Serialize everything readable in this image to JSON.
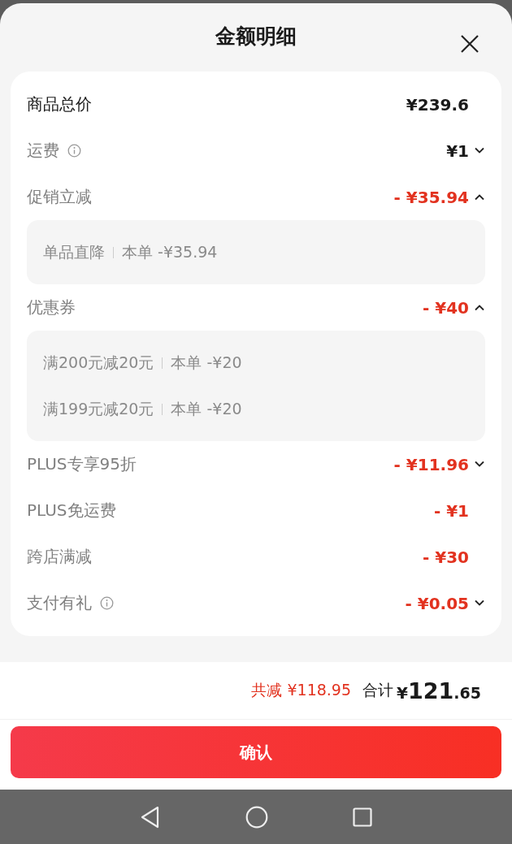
{
  "title": "金额明细",
  "rows": [
    {
      "label": "商品总价",
      "kind": "total",
      "info": false,
      "amount": "¥239.6",
      "collapsible": false
    },
    {
      "label": "运费",
      "kind": "charge",
      "info": true,
      "amount": "¥1",
      "collapsible": true,
      "expanded": false
    },
    {
      "label": "促销立减",
      "kind": "discount",
      "info": false,
      "amount": "- ¥35.94",
      "collapsible": true,
      "expanded": true,
      "details": [
        {
          "name": "单品直降",
          "value": "本单 -¥35.94"
        }
      ]
    },
    {
      "label": "优惠券",
      "kind": "discount",
      "info": false,
      "amount": "- ¥40",
      "collapsible": true,
      "expanded": true,
      "details": [
        {
          "name": "满200元减20元",
          "value": "本单 -¥20"
        },
        {
          "name": "满199元减20元",
          "value": "本单 -¥20"
        }
      ]
    },
    {
      "label": "PLUS专享95折",
      "kind": "discount",
      "info": false,
      "amount": "- ¥11.96",
      "collapsible": true,
      "expanded": false
    },
    {
      "label": "PLUS免运费",
      "kind": "discount",
      "info": false,
      "amount": "- ¥1",
      "collapsible": false
    },
    {
      "label": "跨店满减",
      "kind": "discount",
      "info": false,
      "amount": "- ¥30",
      "collapsible": false
    },
    {
      "label": "支付有礼",
      "kind": "discount",
      "info": true,
      "amount": "- ¥0.05",
      "collapsible": true,
      "expanded": false
    }
  ],
  "summary": {
    "saved": "共减 ¥118.95",
    "total_label": "合计",
    "total": "¥121.65"
  },
  "confirm_button": "确认"
}
